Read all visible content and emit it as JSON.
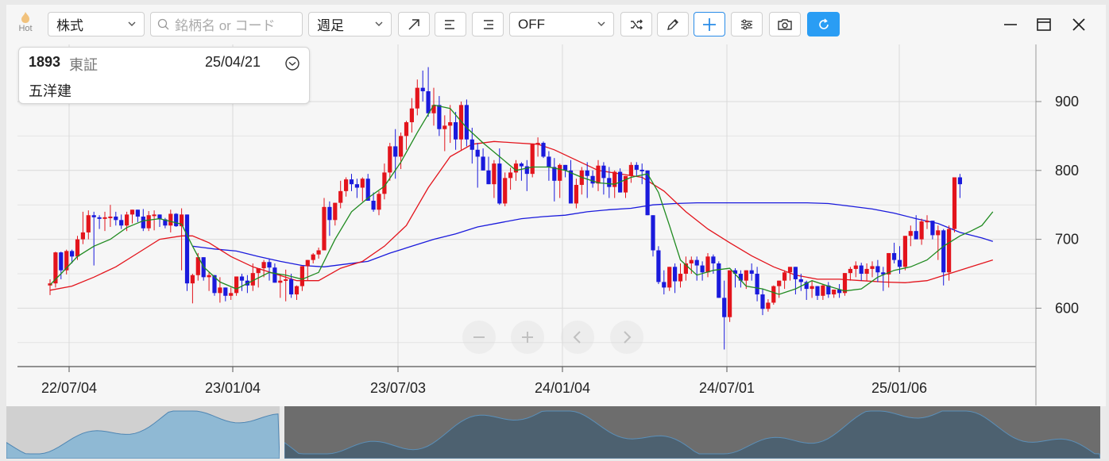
{
  "toolbar": {
    "hot_label": "Hot",
    "market_select": "株式",
    "search_placeholder": "銘柄名 or コード",
    "period_select": "週足",
    "indicator_select": "OFF"
  },
  "info_card": {
    "code": "1893",
    "exchange": "東証",
    "date": "25/04/21",
    "name": "五洋建"
  },
  "chart_data": {
    "type": "candlestick",
    "x_ticks": [
      "22/07/04",
      "23/01/04",
      "23/07/03",
      "24/01/04",
      "24/07/01",
      "25/01/06"
    ],
    "y_ticks": [
      "900",
      "800",
      "700",
      "600"
    ],
    "ylim": [
      520,
      960
    ],
    "colors": {
      "up": "#e3141c",
      "down": "#1a1adc",
      "ma_short": "#1f8a1f",
      "ma_mid": "#e3141c",
      "ma_long": "#1a1adc"
    },
    "candles": [
      [
        633,
        642,
        619,
        636
      ],
      [
        636,
        682,
        630,
        681
      ],
      [
        681,
        682,
        642,
        655
      ],
      [
        655,
        685,
        649,
        683
      ],
      [
        683,
        685,
        665,
        675
      ],
      [
        675,
        705,
        670,
        700
      ],
      [
        700,
        740,
        693,
        710
      ],
      [
        710,
        742,
        700,
        735
      ],
      [
        735,
        740,
        662,
        732
      ],
      [
        732,
        735,
        715,
        730
      ],
      [
        730,
        740,
        712,
        732
      ],
      [
        732,
        750,
        718,
        733
      ],
      [
        733,
        740,
        720,
        728
      ],
      [
        728,
        736,
        715,
        720
      ],
      [
        720,
        740,
        712,
        736
      ],
      [
        736,
        742,
        723,
        743
      ],
      [
        743,
        742,
        725,
        733
      ],
      [
        733,
        744,
        712,
        716
      ],
      [
        716,
        741,
        712,
        735
      ],
      [
        735,
        742,
        713,
        736
      ],
      [
        736,
        735,
        718,
        729
      ],
      [
        729,
        731,
        716,
        720
      ],
      [
        720,
        743,
        710,
        737
      ],
      [
        737,
        738,
        718,
        719
      ],
      [
        719,
        745,
        655,
        736
      ],
      [
        736,
        732,
        625,
        636
      ],
      [
        636,
        650,
        607,
        648
      ],
      [
        648,
        680,
        640,
        674
      ],
      [
        674,
        667,
        640,
        645
      ],
      [
        645,
        652,
        625,
        648
      ],
      [
        648,
        642,
        618,
        622
      ],
      [
        622,
        645,
        608,
        630
      ],
      [
        630,
        625,
        610,
        618
      ],
      [
        618,
        630,
        612,
        622
      ],
      [
        622,
        645,
        618,
        646
      ],
      [
        646,
        650,
        625,
        640
      ],
      [
        640,
        648,
        622,
        633
      ],
      [
        633,
        665,
        625,
        651
      ],
      [
        651,
        655,
        630,
        658
      ],
      [
        658,
        670,
        645,
        667
      ],
      [
        667,
        671,
        640,
        659
      ],
      [
        659,
        665,
        645,
        637
      ],
      [
        637,
        650,
        615,
        640
      ],
      [
        640,
        656,
        610,
        642
      ],
      [
        642,
        650,
        615,
        620
      ],
      [
        620,
        633,
        612,
        632
      ],
      [
        632,
        660,
        625,
        661
      ],
      [
        661,
        670,
        640,
        670
      ],
      [
        670,
        680,
        665,
        678
      ],
      [
        678,
        688,
        672,
        684
      ],
      [
        684,
        760,
        685,
        747
      ],
      [
        747,
        755,
        705,
        728
      ],
      [
        728,
        748,
        720,
        753
      ],
      [
        753,
        785,
        745,
        770
      ],
      [
        770,
        790,
        762,
        787
      ],
      [
        787,
        795,
        770,
        780
      ],
      [
        780,
        788,
        760,
        775
      ],
      [
        775,
        790,
        755,
        788
      ],
      [
        788,
        795,
        762,
        756
      ],
      [
        756,
        768,
        740,
        743
      ],
      [
        743,
        770,
        735,
        766
      ],
      [
        766,
        810,
        758,
        797
      ],
      [
        797,
        840,
        785,
        835
      ],
      [
        835,
        860,
        788,
        820
      ],
      [
        820,
        855,
        802,
        850
      ],
      [
        850,
        872,
        830,
        870
      ],
      [
        870,
        905,
        855,
        890
      ],
      [
        890,
        932,
        880,
        920
      ],
      [
        920,
        945,
        900,
        915
      ],
      [
        915,
        950,
        878,
        883
      ],
      [
        883,
        920,
        865,
        895
      ],
      [
        895,
        908,
        850,
        860
      ],
      [
        860,
        880,
        828,
        865
      ],
      [
        865,
        895,
        840,
        870
      ],
      [
        870,
        885,
        830,
        845
      ],
      [
        845,
        900,
        830,
        895
      ],
      [
        895,
        903,
        835,
        845
      ],
      [
        845,
        862,
        810,
        830
      ],
      [
        830,
        840,
        775,
        820
      ],
      [
        820,
        832,
        800,
        800
      ],
      [
        800,
        820,
        785,
        780
      ],
      [
        780,
        815,
        760,
        810
      ],
      [
        810,
        832,
        750,
        752
      ],
      [
        752,
        797,
        748,
        789
      ],
      [
        789,
        804,
        772,
        797
      ],
      [
        797,
        815,
        785,
        810
      ],
      [
        810,
        812,
        785,
        806
      ],
      [
        806,
        815,
        770,
        795
      ],
      [
        795,
        830,
        790,
        838
      ],
      [
        838,
        848,
        820,
        840
      ],
      [
        840,
        842,
        818,
        820
      ],
      [
        820,
        828,
        785,
        805
      ],
      [
        805,
        818,
        755,
        785
      ],
      [
        785,
        810,
        760,
        808
      ],
      [
        808,
        808,
        790,
        800
      ],
      [
        800,
        815,
        755,
        752
      ],
      [
        752,
        788,
        745,
        779
      ],
      [
        779,
        805,
        765,
        800
      ],
      [
        800,
        812,
        760,
        792
      ],
      [
        792,
        800,
        775,
        781
      ],
      [
        781,
        815,
        770,
        807
      ],
      [
        807,
        812,
        765,
        789
      ],
      [
        789,
        805,
        760,
        776
      ],
      [
        776,
        800,
        760,
        798
      ],
      [
        798,
        803,
        770,
        768
      ],
      [
        768,
        785,
        760,
        792
      ],
      [
        792,
        812,
        782,
        808
      ],
      [
        808,
        812,
        792,
        801
      ],
      [
        801,
        810,
        780,
        800
      ],
      [
        800,
        795,
        737,
        735
      ],
      [
        735,
        695,
        675,
        684
      ],
      [
        684,
        690,
        635,
        638
      ],
      [
        638,
        655,
        620,
        630
      ],
      [
        630,
        660,
        625,
        660
      ],
      [
        660,
        665,
        622,
        639
      ],
      [
        639,
        665,
        630,
        650
      ],
      [
        650,
        675,
        640,
        665
      ],
      [
        665,
        675,
        650,
        670
      ],
      [
        670,
        675,
        640,
        662
      ],
      [
        662,
        668,
        640,
        652
      ],
      [
        652,
        680,
        645,
        675
      ],
      [
        675,
        678,
        650,
        665
      ],
      [
        665,
        668,
        615,
        615
      ],
      [
        615,
        640,
        540,
        587
      ],
      [
        587,
        655,
        580,
        655
      ],
      [
        655,
        658,
        630,
        650
      ],
      [
        650,
        655,
        630,
        640
      ],
      [
        640,
        655,
        628,
        655
      ],
      [
        655,
        665,
        640,
        650
      ],
      [
        650,
        660,
        610,
        620
      ],
      [
        620,
        628,
        590,
        599
      ],
      [
        599,
        613,
        595,
        608
      ],
      [
        608,
        633,
        605,
        632
      ],
      [
        632,
        640,
        615,
        640
      ],
      [
        640,
        655,
        628,
        652
      ],
      [
        652,
        660,
        640,
        660
      ],
      [
        660,
        655,
        620,
        642
      ],
      [
        642,
        650,
        625,
        638
      ],
      [
        638,
        640,
        612,
        628
      ],
      [
        628,
        640,
        615,
        632
      ],
      [
        632,
        625,
        612,
        618
      ],
      [
        618,
        635,
        612,
        633
      ],
      [
        633,
        638,
        615,
        620
      ],
      [
        620,
        625,
        615,
        627
      ],
      [
        627,
        635,
        615,
        622
      ],
      [
        622,
        650,
        618,
        651
      ],
      [
        651,
        660,
        640,
        657
      ],
      [
        657,
        668,
        645,
        662
      ],
      [
        662,
        666,
        640,
        650
      ],
      [
        650,
        665,
        640,
        657
      ],
      [
        657,
        668,
        645,
        661
      ],
      [
        661,
        670,
        638,
        652
      ],
      [
        652,
        660,
        625,
        649
      ],
      [
        649,
        680,
        630,
        680
      ],
      [
        680,
        695,
        665,
        670
      ],
      [
        670,
        690,
        650,
        660
      ],
      [
        660,
        705,
        655,
        705
      ],
      [
        705,
        720,
        690,
        712
      ],
      [
        712,
        735,
        700,
        700
      ],
      [
        700,
        730,
        692,
        726
      ],
      [
        726,
        735,
        715,
        727
      ],
      [
        727,
        715,
        700,
        706
      ],
      [
        706,
        720,
        670,
        713
      ],
      [
        713,
        715,
        633,
        652
      ],
      [
        652,
        720,
        640,
        715
      ],
      [
        715,
        790,
        710,
        790
      ],
      [
        790,
        795,
        760,
        780
      ]
    ],
    "ma_short": [
      [
        0,
        634
      ],
      [
        2,
        650
      ],
      [
        5,
        675
      ],
      [
        8,
        690
      ],
      [
        11,
        700
      ],
      [
        14,
        717
      ],
      [
        17,
        727
      ],
      [
        20,
        730
      ],
      [
        24,
        722
      ],
      [
        26,
        690
      ],
      [
        28,
        660
      ],
      [
        31,
        638
      ],
      [
        34,
        628
      ],
      [
        37,
        640
      ],
      [
        40,
        652
      ],
      [
        43,
        648
      ],
      [
        46,
        642
      ],
      [
        49,
        652
      ],
      [
        52,
        700
      ],
      [
        55,
        740
      ],
      [
        58,
        760
      ],
      [
        61,
        777
      ],
      [
        64,
        812
      ],
      [
        67,
        855
      ],
      [
        70,
        895
      ],
      [
        73,
        890
      ],
      [
        76,
        862
      ],
      [
        79,
        840
      ],
      [
        82,
        820
      ],
      [
        85,
        800
      ],
      [
        88,
        805
      ],
      [
        91,
        805
      ],
      [
        94,
        800
      ],
      [
        97,
        790
      ],
      [
        100,
        782
      ],
      [
        103,
        780
      ],
      [
        106,
        790
      ],
      [
        109,
        795
      ],
      [
        111,
        768
      ],
      [
        113,
        720
      ],
      [
        115,
        670
      ],
      [
        118,
        648
      ],
      [
        121,
        655
      ],
      [
        124,
        658
      ],
      [
        127,
        632
      ],
      [
        130,
        628
      ],
      [
        133,
        620
      ],
      [
        136,
        628
      ],
      [
        139,
        640
      ],
      [
        142,
        632
      ],
      [
        145,
        625
      ],
      [
        148,
        628
      ],
      [
        151,
        645
      ],
      [
        154,
        655
      ],
      [
        157,
        660
      ],
      [
        160,
        670
      ],
      [
        163,
        690
      ],
      [
        166,
        705
      ],
      [
        168,
        712
      ],
      [
        170,
        720
      ],
      [
        172,
        740
      ]
    ],
    "ma_mid": [
      [
        0,
        626
      ],
      [
        4,
        632
      ],
      [
        8,
        645
      ],
      [
        12,
        660
      ],
      [
        16,
        680
      ],
      [
        20,
        700
      ],
      [
        24,
        705
      ],
      [
        26,
        705
      ],
      [
        29,
        695
      ],
      [
        33,
        675
      ],
      [
        37,
        660
      ],
      [
        41,
        650
      ],
      [
        45,
        640
      ],
      [
        49,
        640
      ],
      [
        53,
        658
      ],
      [
        57,
        668
      ],
      [
        61,
        690
      ],
      [
        65,
        720
      ],
      [
        69,
        775
      ],
      [
        73,
        820
      ],
      [
        77,
        838
      ],
      [
        81,
        842
      ],
      [
        85,
        840
      ],
      [
        89,
        838
      ],
      [
        92,
        830
      ],
      [
        96,
        815
      ],
      [
        100,
        800
      ],
      [
        104,
        795
      ],
      [
        108,
        790
      ],
      [
        112,
        770
      ],
      [
        116,
        740
      ],
      [
        120,
        715
      ],
      [
        124,
        695
      ],
      [
        128,
        676
      ],
      [
        132,
        660
      ],
      [
        136,
        648
      ],
      [
        140,
        642
      ],
      [
        144,
        642
      ],
      [
        148,
        640
      ],
      [
        152,
        638
      ],
      [
        156,
        637
      ],
      [
        160,
        640
      ],
      [
        164,
        650
      ],
      [
        168,
        660
      ],
      [
        172,
        670
      ]
    ],
    "ma_long": [
      [
        26,
        690
      ],
      [
        30,
        686
      ],
      [
        34,
        683
      ],
      [
        38,
        675
      ],
      [
        42,
        668
      ],
      [
        46,
        662
      ],
      [
        50,
        660
      ],
      [
        54,
        664
      ],
      [
        58,
        668
      ],
      [
        62,
        680
      ],
      [
        66,
        690
      ],
      [
        70,
        700
      ],
      [
        74,
        708
      ],
      [
        78,
        718
      ],
      [
        82,
        724
      ],
      [
        86,
        730
      ],
      [
        90,
        733
      ],
      [
        94,
        735
      ],
      [
        98,
        740
      ],
      [
        102,
        743
      ],
      [
        106,
        745
      ],
      [
        110,
        750
      ],
      [
        114,
        752
      ],
      [
        118,
        753
      ],
      [
        122,
        753
      ],
      [
        126,
        753
      ],
      [
        130,
        753
      ],
      [
        134,
        753
      ],
      [
        138,
        753
      ],
      [
        142,
        752
      ],
      [
        146,
        748
      ],
      [
        150,
        744
      ],
      [
        154,
        738
      ],
      [
        158,
        730
      ],
      [
        162,
        723
      ],
      [
        166,
        710
      ],
      [
        170,
        702
      ],
      [
        172,
        697
      ]
    ]
  }
}
